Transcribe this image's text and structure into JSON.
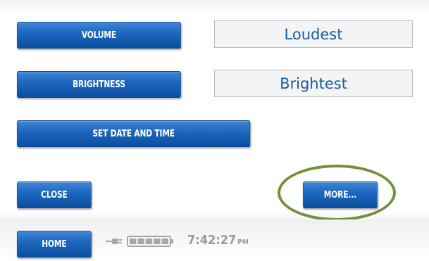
{
  "settings": {
    "volume": {
      "label": "VOLUME",
      "value": "Loudest"
    },
    "brightness": {
      "label": "BRIGHTNESS",
      "value": "Brightest"
    },
    "date_time": {
      "label": "SET DATE AND TIME"
    }
  },
  "actions": {
    "close_label": "CLOSE",
    "more_label": "MORE..."
  },
  "status_bar": {
    "home_label": "HOME",
    "time": "7:42:27",
    "ampm": "PM",
    "battery_segments": 5,
    "plugged_in": true
  },
  "colors": {
    "button_blue": "#1e68c0",
    "value_text": "#1b5aa0",
    "highlight": "#73903a",
    "status_text": "#9a9a9a"
  }
}
